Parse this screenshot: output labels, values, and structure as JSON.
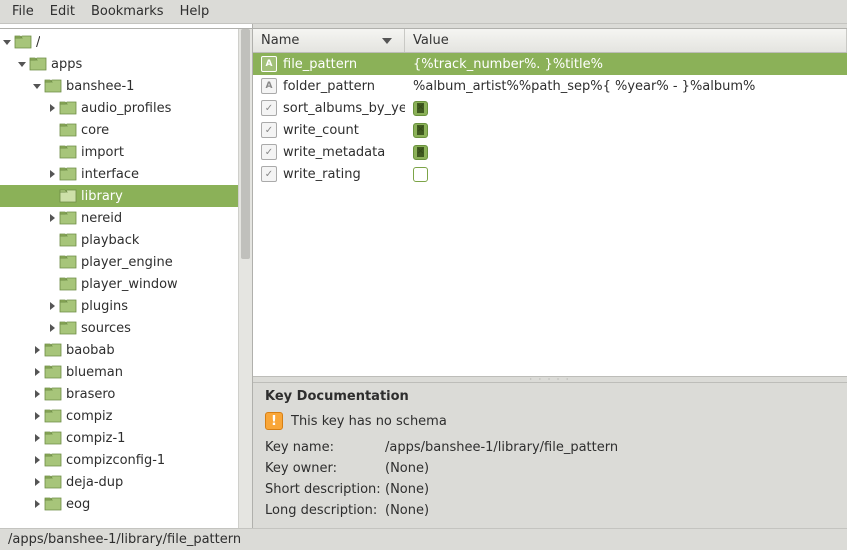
{
  "menubar": [
    "File",
    "Edit",
    "Bookmarks",
    "Help"
  ],
  "tree": [
    {
      "depth": 0,
      "label": "/",
      "expander": "down",
      "selected": false
    },
    {
      "depth": 1,
      "label": "apps",
      "expander": "down",
      "selected": false
    },
    {
      "depth": 2,
      "label": "banshee-1",
      "expander": "down",
      "selected": false
    },
    {
      "depth": 3,
      "label": "audio_profiles",
      "expander": "right",
      "selected": false
    },
    {
      "depth": 3,
      "label": "core",
      "expander": "none",
      "selected": false
    },
    {
      "depth": 3,
      "label": "import",
      "expander": "none",
      "selected": false
    },
    {
      "depth": 3,
      "label": "interface",
      "expander": "right",
      "selected": false
    },
    {
      "depth": 3,
      "label": "library",
      "expander": "none",
      "selected": true
    },
    {
      "depth": 3,
      "label": "nereid",
      "expander": "right",
      "selected": false
    },
    {
      "depth": 3,
      "label": "playback",
      "expander": "none",
      "selected": false
    },
    {
      "depth": 3,
      "label": "player_engine",
      "expander": "none",
      "selected": false
    },
    {
      "depth": 3,
      "label": "player_window",
      "expander": "none",
      "selected": false
    },
    {
      "depth": 3,
      "label": "plugins",
      "expander": "right",
      "selected": false
    },
    {
      "depth": 3,
      "label": "sources",
      "expander": "right",
      "selected": false
    },
    {
      "depth": 2,
      "label": "baobab",
      "expander": "right",
      "selected": false
    },
    {
      "depth": 2,
      "label": "blueman",
      "expander": "right",
      "selected": false
    },
    {
      "depth": 2,
      "label": "brasero",
      "expander": "right",
      "selected": false
    },
    {
      "depth": 2,
      "label": "compiz",
      "expander": "right",
      "selected": false
    },
    {
      "depth": 2,
      "label": "compiz-1",
      "expander": "right",
      "selected": false
    },
    {
      "depth": 2,
      "label": "compizconfig-1",
      "expander": "right",
      "selected": false
    },
    {
      "depth": 2,
      "label": "deja-dup",
      "expander": "right",
      "selected": false
    },
    {
      "depth": 2,
      "label": "eog",
      "expander": "right",
      "selected": false
    }
  ],
  "columns": {
    "name": "Name",
    "value": "Value"
  },
  "keys": [
    {
      "type": "string",
      "name": "file_pattern",
      "value": "{%track_number%. }%title%",
      "selected": true
    },
    {
      "type": "string",
      "name": "folder_pattern",
      "value": "%album_artist%%path_sep%{ %year% - }%album%",
      "selected": false
    },
    {
      "type": "bool",
      "name": "sort_albums_by_year",
      "checked": true,
      "selected": false
    },
    {
      "type": "bool",
      "name": "write_count",
      "checked": true,
      "selected": false
    },
    {
      "type": "bool",
      "name": "write_metadata",
      "checked": true,
      "selected": false
    },
    {
      "type": "bool",
      "name": "write_rating",
      "checked": false,
      "selected": false
    }
  ],
  "doc": {
    "heading": "Key Documentation",
    "warn": "This key has no schema",
    "rows": [
      {
        "label": "Key name:",
        "value": "/apps/banshee-1/library/file_pattern"
      },
      {
        "label": "Key owner:",
        "value": "(None)"
      },
      {
        "label": "Short description:",
        "value": "(None)"
      },
      {
        "label": "Long description:",
        "value": "(None)"
      }
    ]
  },
  "statusbar": "/apps/banshee-1/library/file_pattern"
}
